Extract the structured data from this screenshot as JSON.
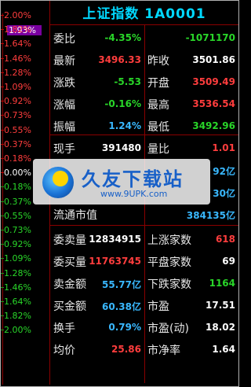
{
  "axis": {
    "highlight": "1.93%",
    "ticks_top": [
      "2.00%",
      "1.82%",
      "1.64%",
      "1.46%",
      "1.28%",
      "1.09%",
      "0.92%",
      "0.73%",
      "0.55%",
      "0.37%",
      "0.18%"
    ],
    "zero": "0.00%",
    "ticks_bottom": [
      "0.18%",
      "0.37%",
      "0.55%",
      "0.73%",
      "0.92%",
      "1.09%",
      "1.28%",
      "1.46%",
      "1.64%",
      "1.82%",
      "2.00%"
    ]
  },
  "panel": {
    "title": "上证指数 1A0001",
    "rows": [
      {
        "l1": "委比",
        "v1": "-4.35%",
        "c1": "green",
        "l2": "",
        "v2": "-1071170",
        "c2": "green"
      },
      {
        "l1": "最新",
        "v1": "3496.33",
        "c1": "red",
        "l2": "昨收",
        "v2": "3501.86",
        "c2": "white"
      },
      {
        "l1": "涨跌",
        "v1": "-5.53",
        "c1": "green",
        "l2": "开盘",
        "v2": "3509.49",
        "c2": "red"
      },
      {
        "l1": "涨幅",
        "v1": "-0.16%",
        "c1": "green",
        "l2": "最高",
        "v2": "3536.54",
        "c2": "red"
      },
      {
        "l1": "振幅",
        "v1": "1.24%",
        "c1": "cyan",
        "l2": "最低",
        "v2": "3492.96",
        "c2": "green"
      },
      {
        "l1": "现手",
        "v1": "391480",
        "c1": "white",
        "l2": "量比",
        "v2": "1.01",
        "c2": "red"
      },
      {
        "l1": "",
        "v1": "",
        "c1": "white",
        "l2": "",
        "v2": "92亿",
        "c2": "cyan"
      },
      {
        "l1": "",
        "v1": "",
        "c1": "white",
        "l2": "",
        "v2": "30亿",
        "c2": "cyan"
      },
      {
        "l1": "流通市值",
        "v1": "",
        "c1": "white",
        "l2": "",
        "v2": "384135亿",
        "c2": "cyan"
      },
      {
        "l1": "委卖量",
        "v1": "12834915",
        "c1": "white",
        "l2": "上涨家数",
        "v2": "618",
        "c2": "red"
      },
      {
        "l1": "委买量",
        "v1": "11763745",
        "c1": "red",
        "l2": "平盘家数",
        "v2": "69",
        "c2": "white"
      },
      {
        "l1": "卖金额",
        "v1": "55.77亿",
        "c1": "cyan",
        "l2": "下跌家数",
        "v2": "1164",
        "c2": "green"
      },
      {
        "l1": "买金额",
        "v1": "60.38亿",
        "c1": "cyan",
        "l2": "市盈",
        "v2": "17.51",
        "c2": "white"
      },
      {
        "l1": "换手",
        "v1": "0.79%",
        "c1": "cyan",
        "l2": "市盈(动)",
        "v2": "18.02",
        "c2": "white"
      },
      {
        "l1": "均价",
        "v1": "25.86",
        "c1": "red",
        "l2": "市净率",
        "v2": "1.64",
        "c2": "white"
      }
    ]
  },
  "watermark": {
    "title": "久友下载站",
    "url": "www.9UPK.com"
  },
  "colors": {
    "red": "#ff3d3d",
    "green": "#29d629",
    "cyan": "#39b8ff",
    "title": "#00d8ff",
    "grid": "#8a0000"
  }
}
